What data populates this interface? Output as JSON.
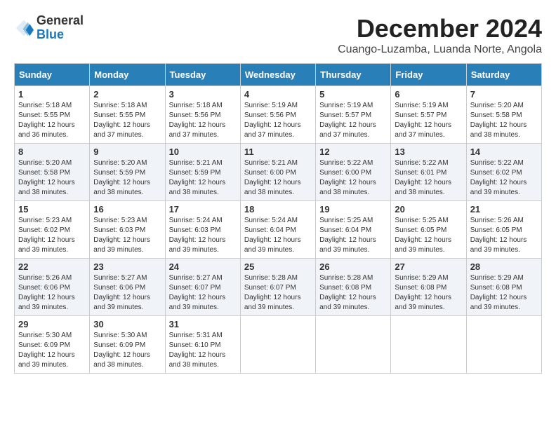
{
  "logo": {
    "general": "General",
    "blue": "Blue"
  },
  "title": "December 2024",
  "subtitle": "Cuango-Luzamba, Luanda Norte, Angola",
  "weekdays": [
    "Sunday",
    "Monday",
    "Tuesday",
    "Wednesday",
    "Thursday",
    "Friday",
    "Saturday"
  ],
  "weeks": [
    [
      {
        "day": "1",
        "sunrise": "5:18 AM",
        "sunset": "5:55 PM",
        "daylight": "12 hours and 36 minutes."
      },
      {
        "day": "2",
        "sunrise": "5:18 AM",
        "sunset": "5:55 PM",
        "daylight": "12 hours and 37 minutes."
      },
      {
        "day": "3",
        "sunrise": "5:18 AM",
        "sunset": "5:56 PM",
        "daylight": "12 hours and 37 minutes."
      },
      {
        "day": "4",
        "sunrise": "5:19 AM",
        "sunset": "5:56 PM",
        "daylight": "12 hours and 37 minutes."
      },
      {
        "day": "5",
        "sunrise": "5:19 AM",
        "sunset": "5:57 PM",
        "daylight": "12 hours and 37 minutes."
      },
      {
        "day": "6",
        "sunrise": "5:19 AM",
        "sunset": "5:57 PM",
        "daylight": "12 hours and 37 minutes."
      },
      {
        "day": "7",
        "sunrise": "5:20 AM",
        "sunset": "5:58 PM",
        "daylight": "12 hours and 38 minutes."
      }
    ],
    [
      {
        "day": "8",
        "sunrise": "5:20 AM",
        "sunset": "5:58 PM",
        "daylight": "12 hours and 38 minutes."
      },
      {
        "day": "9",
        "sunrise": "5:20 AM",
        "sunset": "5:59 PM",
        "daylight": "12 hours and 38 minutes."
      },
      {
        "day": "10",
        "sunrise": "5:21 AM",
        "sunset": "5:59 PM",
        "daylight": "12 hours and 38 minutes."
      },
      {
        "day": "11",
        "sunrise": "5:21 AM",
        "sunset": "6:00 PM",
        "daylight": "12 hours and 38 minutes."
      },
      {
        "day": "12",
        "sunrise": "5:22 AM",
        "sunset": "6:00 PM",
        "daylight": "12 hours and 38 minutes."
      },
      {
        "day": "13",
        "sunrise": "5:22 AM",
        "sunset": "6:01 PM",
        "daylight": "12 hours and 38 minutes."
      },
      {
        "day": "14",
        "sunrise": "5:22 AM",
        "sunset": "6:02 PM",
        "daylight": "12 hours and 39 minutes."
      }
    ],
    [
      {
        "day": "15",
        "sunrise": "5:23 AM",
        "sunset": "6:02 PM",
        "daylight": "12 hours and 39 minutes."
      },
      {
        "day": "16",
        "sunrise": "5:23 AM",
        "sunset": "6:03 PM",
        "daylight": "12 hours and 39 minutes."
      },
      {
        "day": "17",
        "sunrise": "5:24 AM",
        "sunset": "6:03 PM",
        "daylight": "12 hours and 39 minutes."
      },
      {
        "day": "18",
        "sunrise": "5:24 AM",
        "sunset": "6:04 PM",
        "daylight": "12 hours and 39 minutes."
      },
      {
        "day": "19",
        "sunrise": "5:25 AM",
        "sunset": "6:04 PM",
        "daylight": "12 hours and 39 minutes."
      },
      {
        "day": "20",
        "sunrise": "5:25 AM",
        "sunset": "6:05 PM",
        "daylight": "12 hours and 39 minutes."
      },
      {
        "day": "21",
        "sunrise": "5:26 AM",
        "sunset": "6:05 PM",
        "daylight": "12 hours and 39 minutes."
      }
    ],
    [
      {
        "day": "22",
        "sunrise": "5:26 AM",
        "sunset": "6:06 PM",
        "daylight": "12 hours and 39 minutes."
      },
      {
        "day": "23",
        "sunrise": "5:27 AM",
        "sunset": "6:06 PM",
        "daylight": "12 hours and 39 minutes."
      },
      {
        "day": "24",
        "sunrise": "5:27 AM",
        "sunset": "6:07 PM",
        "daylight": "12 hours and 39 minutes."
      },
      {
        "day": "25",
        "sunrise": "5:28 AM",
        "sunset": "6:07 PM",
        "daylight": "12 hours and 39 minutes."
      },
      {
        "day": "26",
        "sunrise": "5:28 AM",
        "sunset": "6:08 PM",
        "daylight": "12 hours and 39 minutes."
      },
      {
        "day": "27",
        "sunrise": "5:29 AM",
        "sunset": "6:08 PM",
        "daylight": "12 hours and 39 minutes."
      },
      {
        "day": "28",
        "sunrise": "5:29 AM",
        "sunset": "6:08 PM",
        "daylight": "12 hours and 39 minutes."
      }
    ],
    [
      {
        "day": "29",
        "sunrise": "5:30 AM",
        "sunset": "6:09 PM",
        "daylight": "12 hours and 39 minutes."
      },
      {
        "day": "30",
        "sunrise": "5:30 AM",
        "sunset": "6:09 PM",
        "daylight": "12 hours and 38 minutes."
      },
      {
        "day": "31",
        "sunrise": "5:31 AM",
        "sunset": "6:10 PM",
        "daylight": "12 hours and 38 minutes."
      },
      null,
      null,
      null,
      null
    ]
  ],
  "labels": {
    "sunrise": "Sunrise:",
    "sunset": "Sunset:",
    "daylight": "Daylight:"
  }
}
